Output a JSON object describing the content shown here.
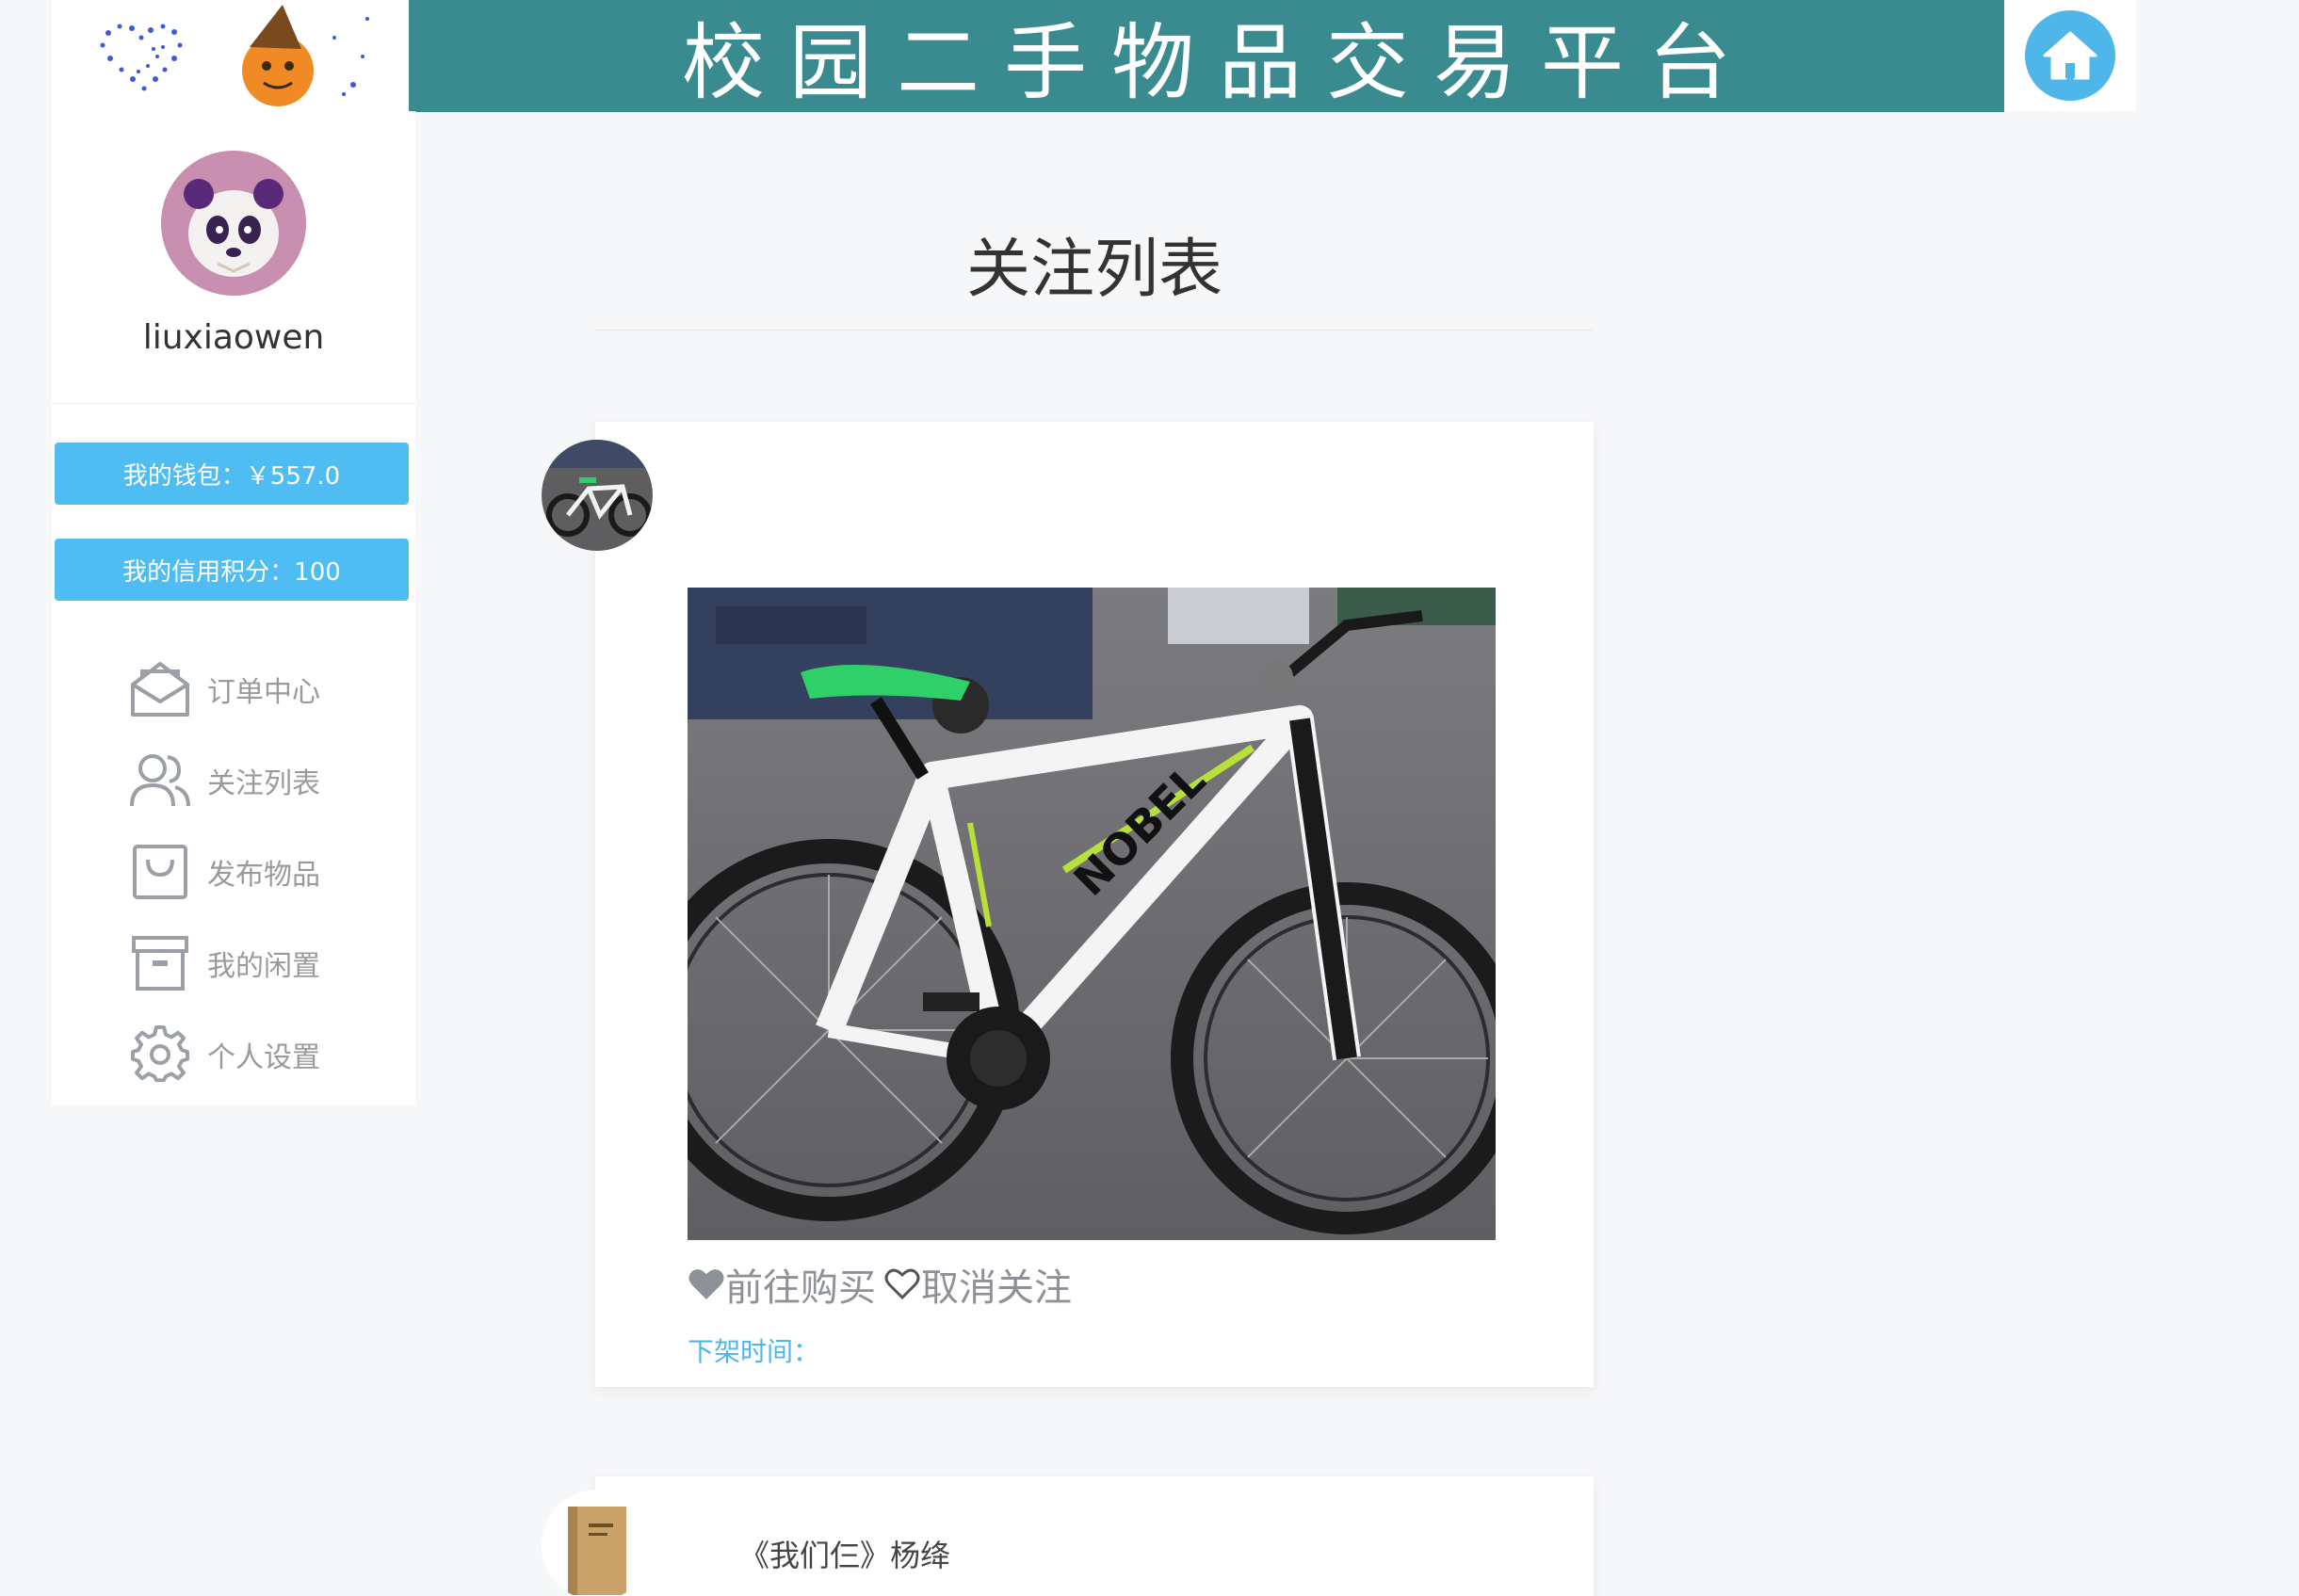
{
  "header": {
    "title": "校园二手物品交易平台",
    "home_icon": "home-icon",
    "banner_color": "#3a8b8f"
  },
  "user": {
    "name": "liuxiaowen",
    "wallet_label": "我的钱包：￥557.0",
    "credit_label": "我的信用积分：100"
  },
  "menu": [
    {
      "label": "订单中心",
      "icon": "envelope-open-icon"
    },
    {
      "label": "关注列表",
      "icon": "users-icon"
    },
    {
      "label": "发布物品",
      "icon": "shopping-bag-icon"
    },
    {
      "label": "我的闲置",
      "icon": "archive-box-icon"
    },
    {
      "label": "个人设置",
      "icon": "gear-icon"
    }
  ],
  "main": {
    "page_title": "关注列表",
    "items": [
      {
        "title": "",
        "buy_label": "前往购买",
        "unfollow_label": "取消关注",
        "offshelf_label": "下架时间："
      },
      {
        "title": "《我们仨》杨绛"
      }
    ]
  },
  "colors": {
    "accent": "#4fbdf1",
    "link": "#4fb6ea",
    "muted": "#9a9a9a"
  }
}
